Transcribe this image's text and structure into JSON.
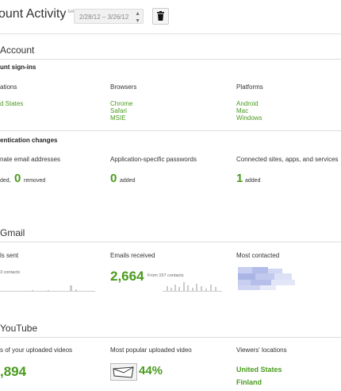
{
  "header": {
    "title": "ount Activity",
    "beta": "beta",
    "date_range": "2/28/12 – 3/26/12"
  },
  "account": {
    "title": "Account",
    "signins": {
      "title": "unt sign-ins",
      "locations": {
        "title": "ations",
        "items": [
          "d States"
        ]
      },
      "browsers": {
        "title": "Browsers",
        "items": [
          "Chrome",
          "Safari",
          "MSIE"
        ]
      },
      "platforms": {
        "title": "Platforms",
        "items": [
          "Android",
          "Mac",
          "Windows"
        ]
      }
    },
    "auth": {
      "title": "entication changes",
      "alternate_email": {
        "title": "nate email addresses",
        "added_suffix": "ded,",
        "removed_value": "0",
        "removed_label": "removed"
      },
      "app_passwords": {
        "title": "Application-specific passwords",
        "value": "0",
        "label": "added"
      },
      "connected_sites": {
        "title": "Connected sites, apps, and services",
        "value": "1",
        "label": "added"
      }
    }
  },
  "gmail": {
    "title": "Gmail",
    "emails_sent": {
      "title": "ls sent",
      "contacts": "3 contacts"
    },
    "emails_received": {
      "title": "Emails received",
      "value": "2,664",
      "from": "From 157 contacts"
    },
    "most_contacted": {
      "title": "Most contacted"
    }
  },
  "youtube": {
    "title": "YouTube",
    "views": {
      "title": "s of your uploaded videos",
      "value": ",894"
    },
    "popular": {
      "title": "Most popular uploaded video",
      "value": "44%"
    },
    "viewers": {
      "title": "Viewers' locations",
      "locations": [
        "United States",
        "Finland"
      ]
    }
  },
  "colors": {
    "accent": "#4a9b1e",
    "divider": "#dddddd",
    "blur": "#b9c3ea"
  },
  "icons": {
    "trash": "trash-icon",
    "stepper": "up-down-stepper-icon"
  }
}
